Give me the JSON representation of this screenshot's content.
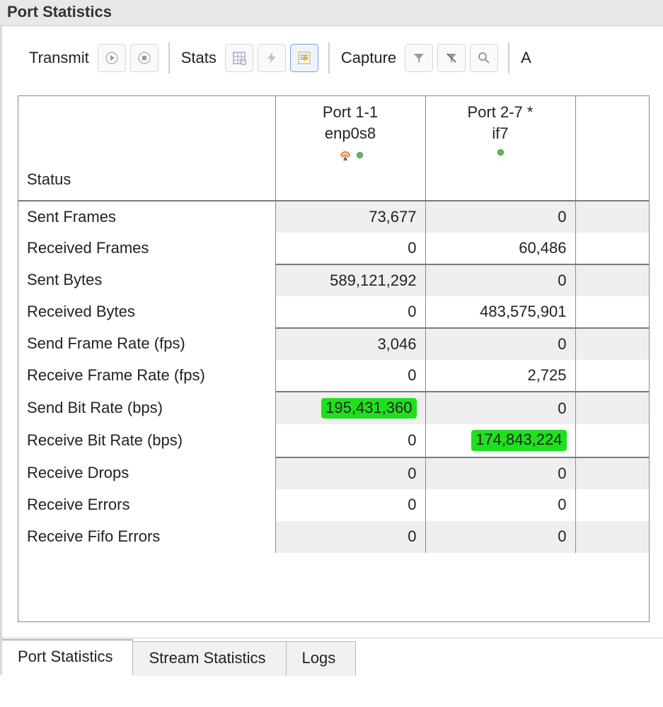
{
  "window": {
    "title": "Port Statistics"
  },
  "toolbar": {
    "transmit_label": "Transmit",
    "stats_label": "Stats",
    "capture_label": "Capture",
    "trailing_char": "A"
  },
  "headers": {
    "status_label": "Status",
    "ports": [
      {
        "name": "Port 1-1",
        "iface": "enp0s8",
        "has_radio_icon": true
      },
      {
        "name": "Port 2-7 *",
        "iface": "if7",
        "has_radio_icon": false
      }
    ]
  },
  "rows": [
    {
      "label": "Sent Frames",
      "p1": "73,677",
      "p2": "0",
      "section": true
    },
    {
      "label": "Received Frames",
      "p1": "0",
      "p2": "60,486",
      "section": false
    },
    {
      "label": "Sent Bytes",
      "p1": "589,121,292",
      "p2": "0",
      "section": true
    },
    {
      "label": "Received Bytes",
      "p1": "0",
      "p2": "483,575,901",
      "section": false
    },
    {
      "label": "Send Frame Rate (fps)",
      "p1": "3,046",
      "p2": "0",
      "section": true
    },
    {
      "label": "Receive Frame Rate (fps)",
      "p1": "0",
      "p2": "2,725",
      "section": false
    },
    {
      "label": "Send Bit Rate (bps)",
      "p1": "195,431,360",
      "p2": "0",
      "section": true,
      "hl_p1": true
    },
    {
      "label": "Receive Bit Rate (bps)",
      "p1": "0",
      "p2": "174,843,224",
      "section": false,
      "hl_p2": true
    },
    {
      "label": "Receive Drops",
      "p1": "0",
      "p2": "0",
      "section": true
    },
    {
      "label": "Receive Errors",
      "p1": "0",
      "p2": "0",
      "section": false
    },
    {
      "label": "Receive Fifo Errors",
      "p1": "0",
      "p2": "0",
      "section": false
    }
  ],
  "tabs": {
    "items": [
      {
        "label": "Port Statistics",
        "active": true
      },
      {
        "label": "Stream Statistics",
        "active": false
      },
      {
        "label": "Logs",
        "active": false
      }
    ]
  }
}
